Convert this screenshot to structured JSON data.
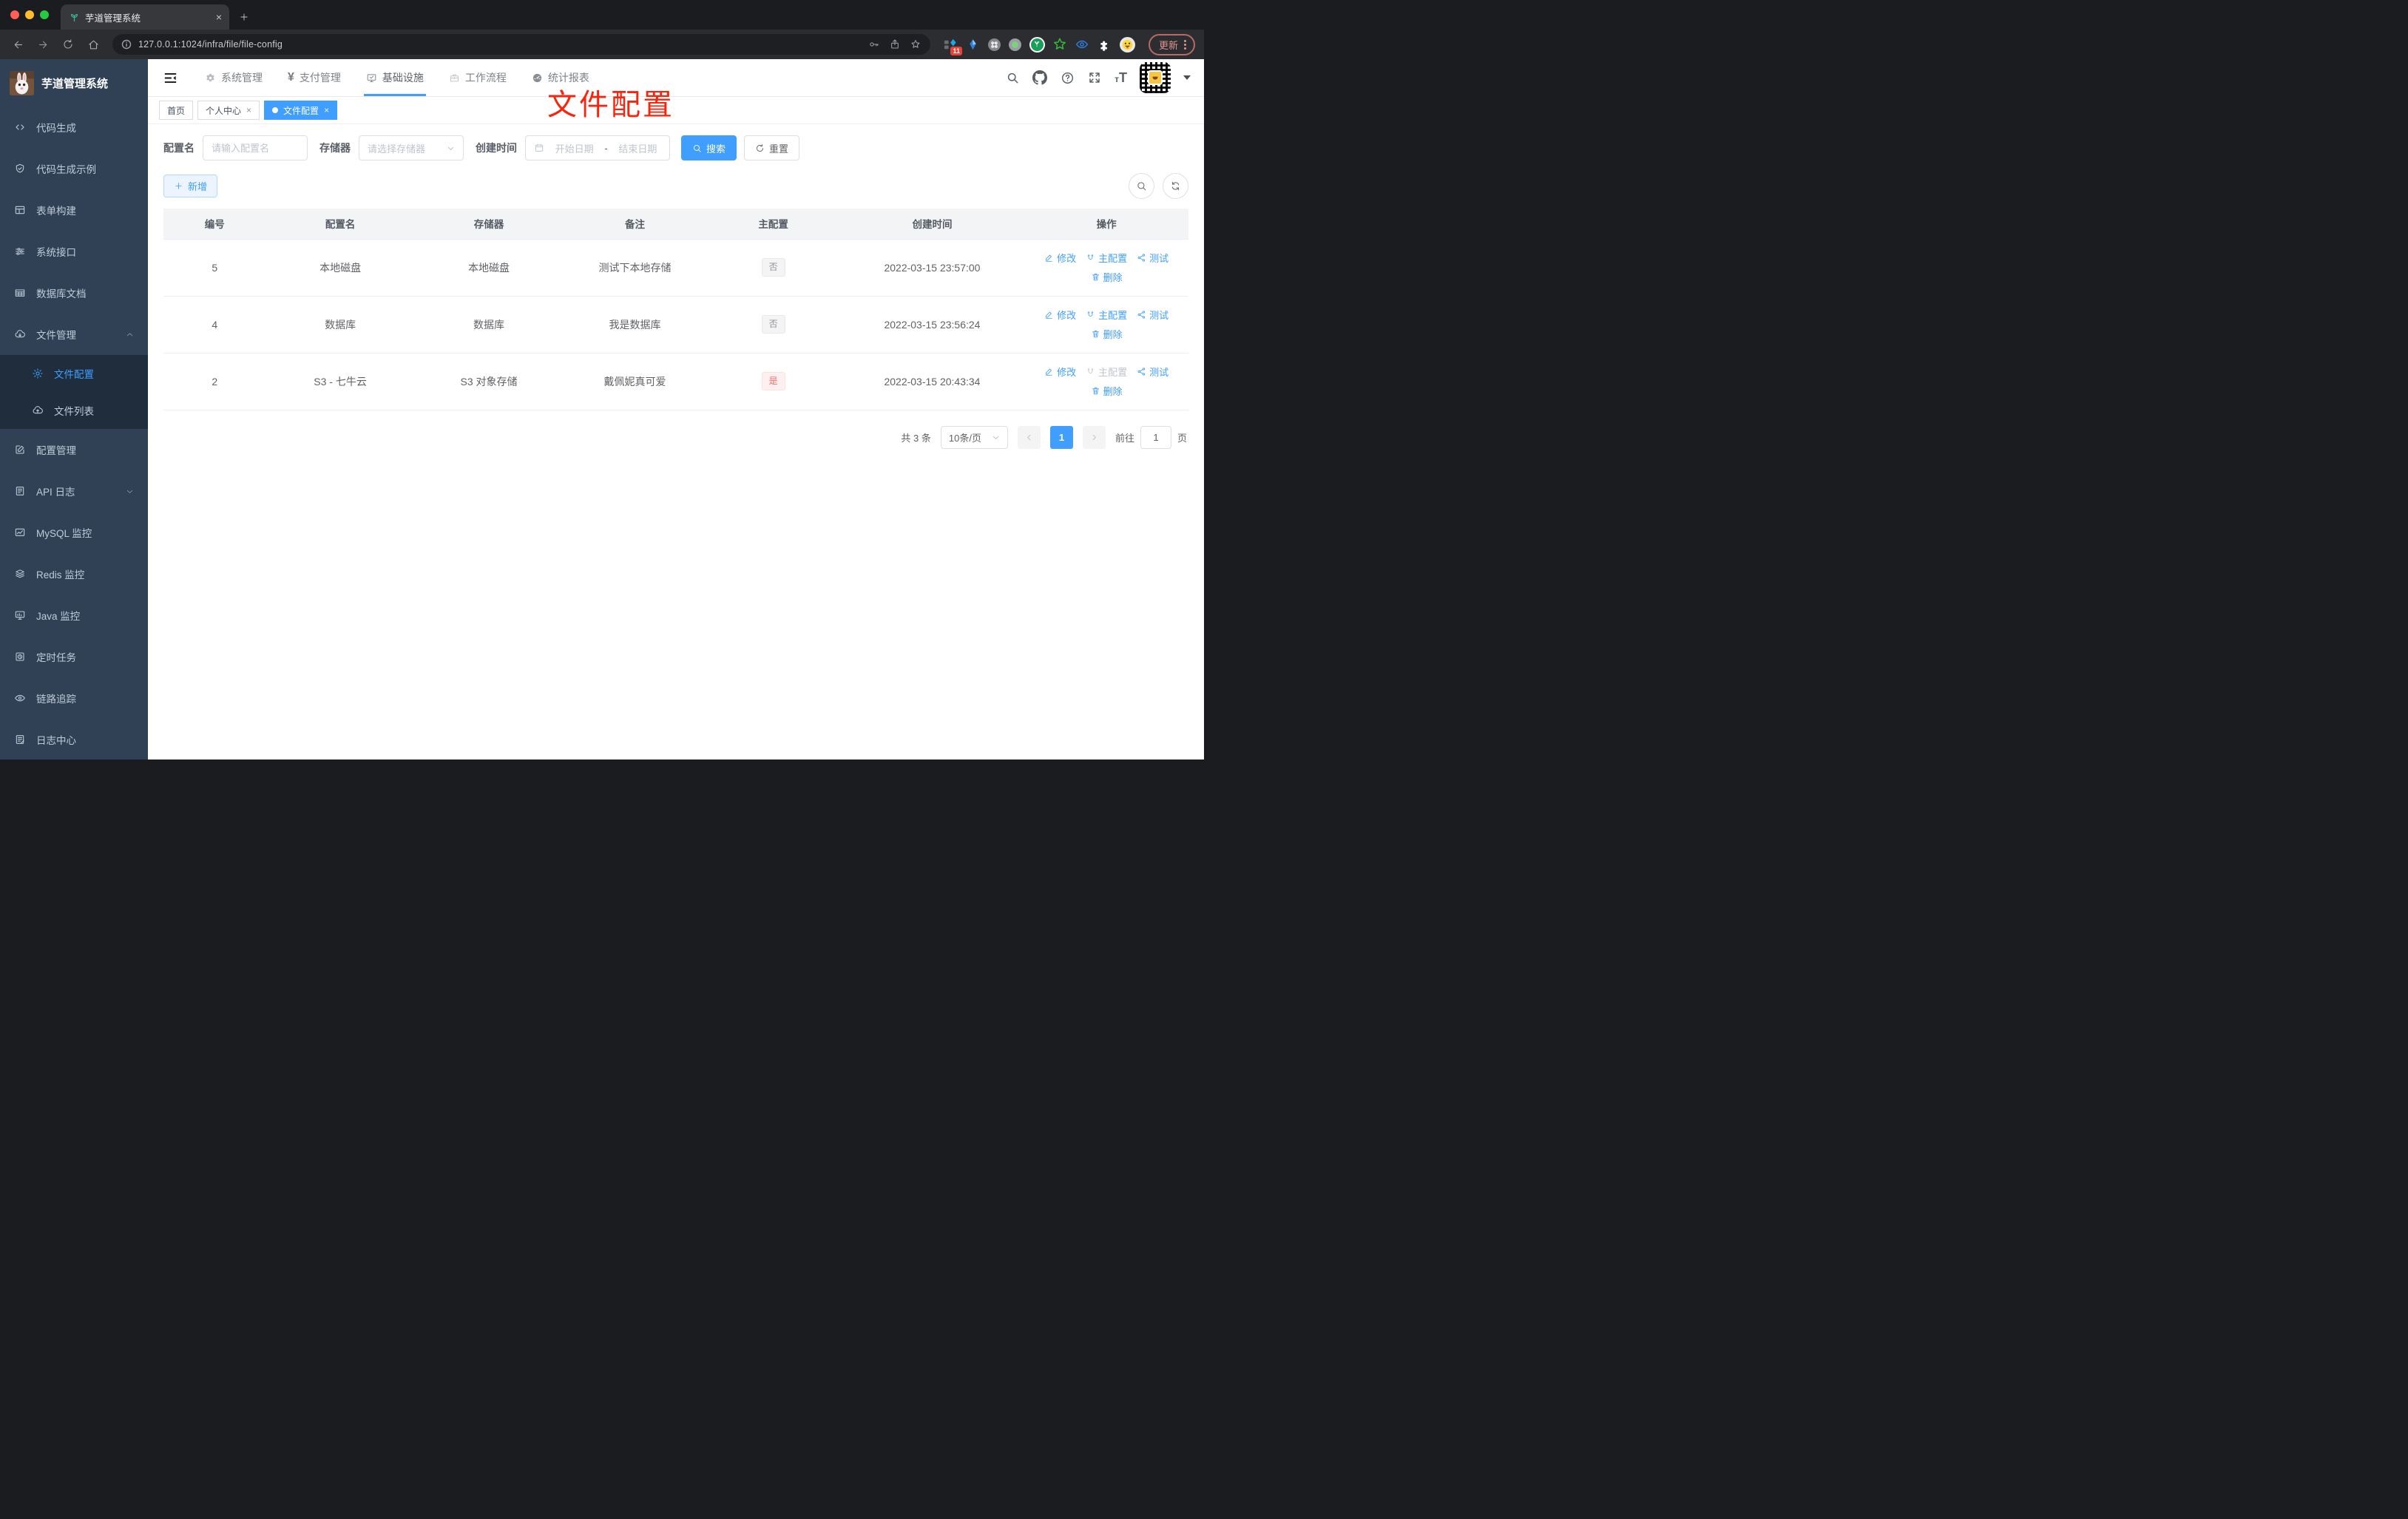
{
  "browser": {
    "tab_title": "芋道管理系统",
    "url": "127.0.0.1:1024/infra/file/file-config",
    "ext_badge": "11",
    "update_label": "更新"
  },
  "annotation": {
    "text": "文件配置",
    "color": "#f5260d"
  },
  "sidebar": {
    "title": "芋道管理系统",
    "items": [
      "代码生成",
      "代码生成示例",
      "表单构建",
      "系统接口",
      "数据库文档",
      "文件管理",
      "文件配置",
      "文件列表",
      "配置管理",
      "API 日志",
      "MySQL 监控",
      "Redis 监控",
      "Java 监控",
      "定时任务",
      "链路追踪",
      "日志中心"
    ]
  },
  "nav": {
    "items": [
      "系统管理",
      "支付管理",
      "基础设施",
      "工作流程",
      "统计报表"
    ]
  },
  "tags": {
    "items": [
      "首页",
      "个人中心",
      "文件配置"
    ]
  },
  "filter": {
    "name_label": "配置名",
    "name_placeholder": "请输入配置名",
    "storage_label": "存储器",
    "storage_placeholder": "请选择存储器",
    "time_label": "创建时间",
    "start_placeholder": "开始日期",
    "range_sep": "-",
    "end_placeholder": "结束日期",
    "search_label": "搜索",
    "reset_label": "重置",
    "add_label": "新增"
  },
  "table": {
    "columns": [
      "编号",
      "配置名",
      "存储器",
      "备注",
      "主配置",
      "创建时间",
      "操作"
    ],
    "ops": {
      "edit": "修改",
      "master": "主配置",
      "test": "测试",
      "del": "删除"
    },
    "rows": [
      {
        "id": "5",
        "name": "本地磁盘",
        "storage": "本地磁盘",
        "remark": "测试下本地存储",
        "master": "否",
        "tag_class": "tag info",
        "master_link_class": "op",
        "created": "2022-03-15 23:57:00"
      },
      {
        "id": "4",
        "name": "数据库",
        "storage": "数据库",
        "remark": "我是数据库",
        "master": "否",
        "tag_class": "tag info",
        "master_link_class": "op",
        "created": "2022-03-15 23:56:24"
      },
      {
        "id": "2",
        "name": "S3 - 七牛云",
        "storage": "S3 对象存储",
        "remark": "戴佩妮真可爱",
        "master": "是",
        "tag_class": "tag danger",
        "master_link_class": "op disabled",
        "created": "2022-03-15 20:43:34"
      }
    ]
  },
  "pagination": {
    "total": "共 3 条",
    "page_size": "10条/页",
    "page": "1",
    "goto_label": "前往",
    "goto_value": "1",
    "page_unit": "页"
  },
  "colors": {
    "accent": "#409eff",
    "sidebar_bg": "#304156",
    "submenu_bg": "#1f2d3d"
  }
}
